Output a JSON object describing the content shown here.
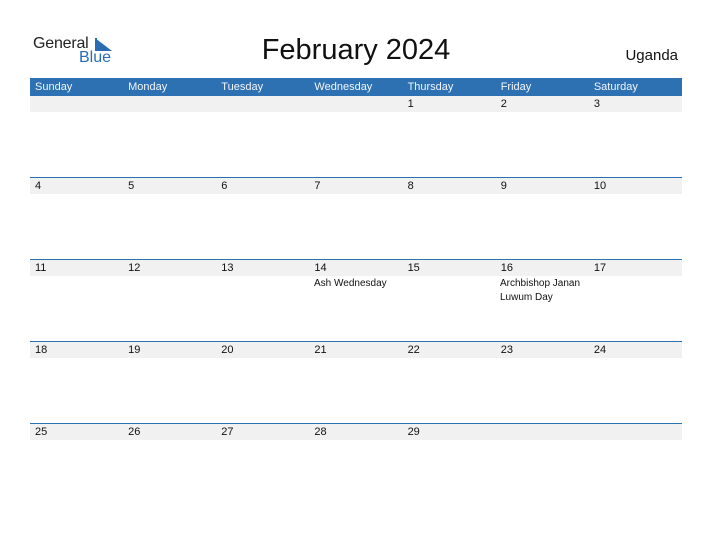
{
  "logo": {
    "general": "General",
    "blue": "Blue"
  },
  "title": "February 2024",
  "country": "Uganda",
  "colors": {
    "accent": "#2e71b3",
    "strip": "#f1f1f1"
  },
  "weekdays": [
    "Sunday",
    "Monday",
    "Tuesday",
    "Wednesday",
    "Thursday",
    "Friday",
    "Saturday"
  ],
  "weeks": [
    {
      "days": [
        "",
        "",
        "",
        "",
        "1",
        "2",
        "3"
      ],
      "events": [
        "",
        "",
        "",
        "",
        "",
        "",
        ""
      ]
    },
    {
      "days": [
        "4",
        "5",
        "6",
        "7",
        "8",
        "9",
        "10"
      ],
      "events": [
        "",
        "",
        "",
        "",
        "",
        "",
        ""
      ]
    },
    {
      "days": [
        "11",
        "12",
        "13",
        "14",
        "15",
        "16",
        "17"
      ],
      "events": [
        "",
        "",
        "",
        "Ash Wednesday",
        "",
        "Archbishop Janan Luwum Day",
        ""
      ]
    },
    {
      "days": [
        "18",
        "19",
        "20",
        "21",
        "22",
        "23",
        "24"
      ],
      "events": [
        "",
        "",
        "",
        "",
        "",
        "",
        ""
      ]
    },
    {
      "days": [
        "25",
        "26",
        "27",
        "28",
        "29",
        "",
        ""
      ],
      "events": [
        "",
        "",
        "",
        "",
        "",
        "",
        ""
      ]
    }
  ]
}
